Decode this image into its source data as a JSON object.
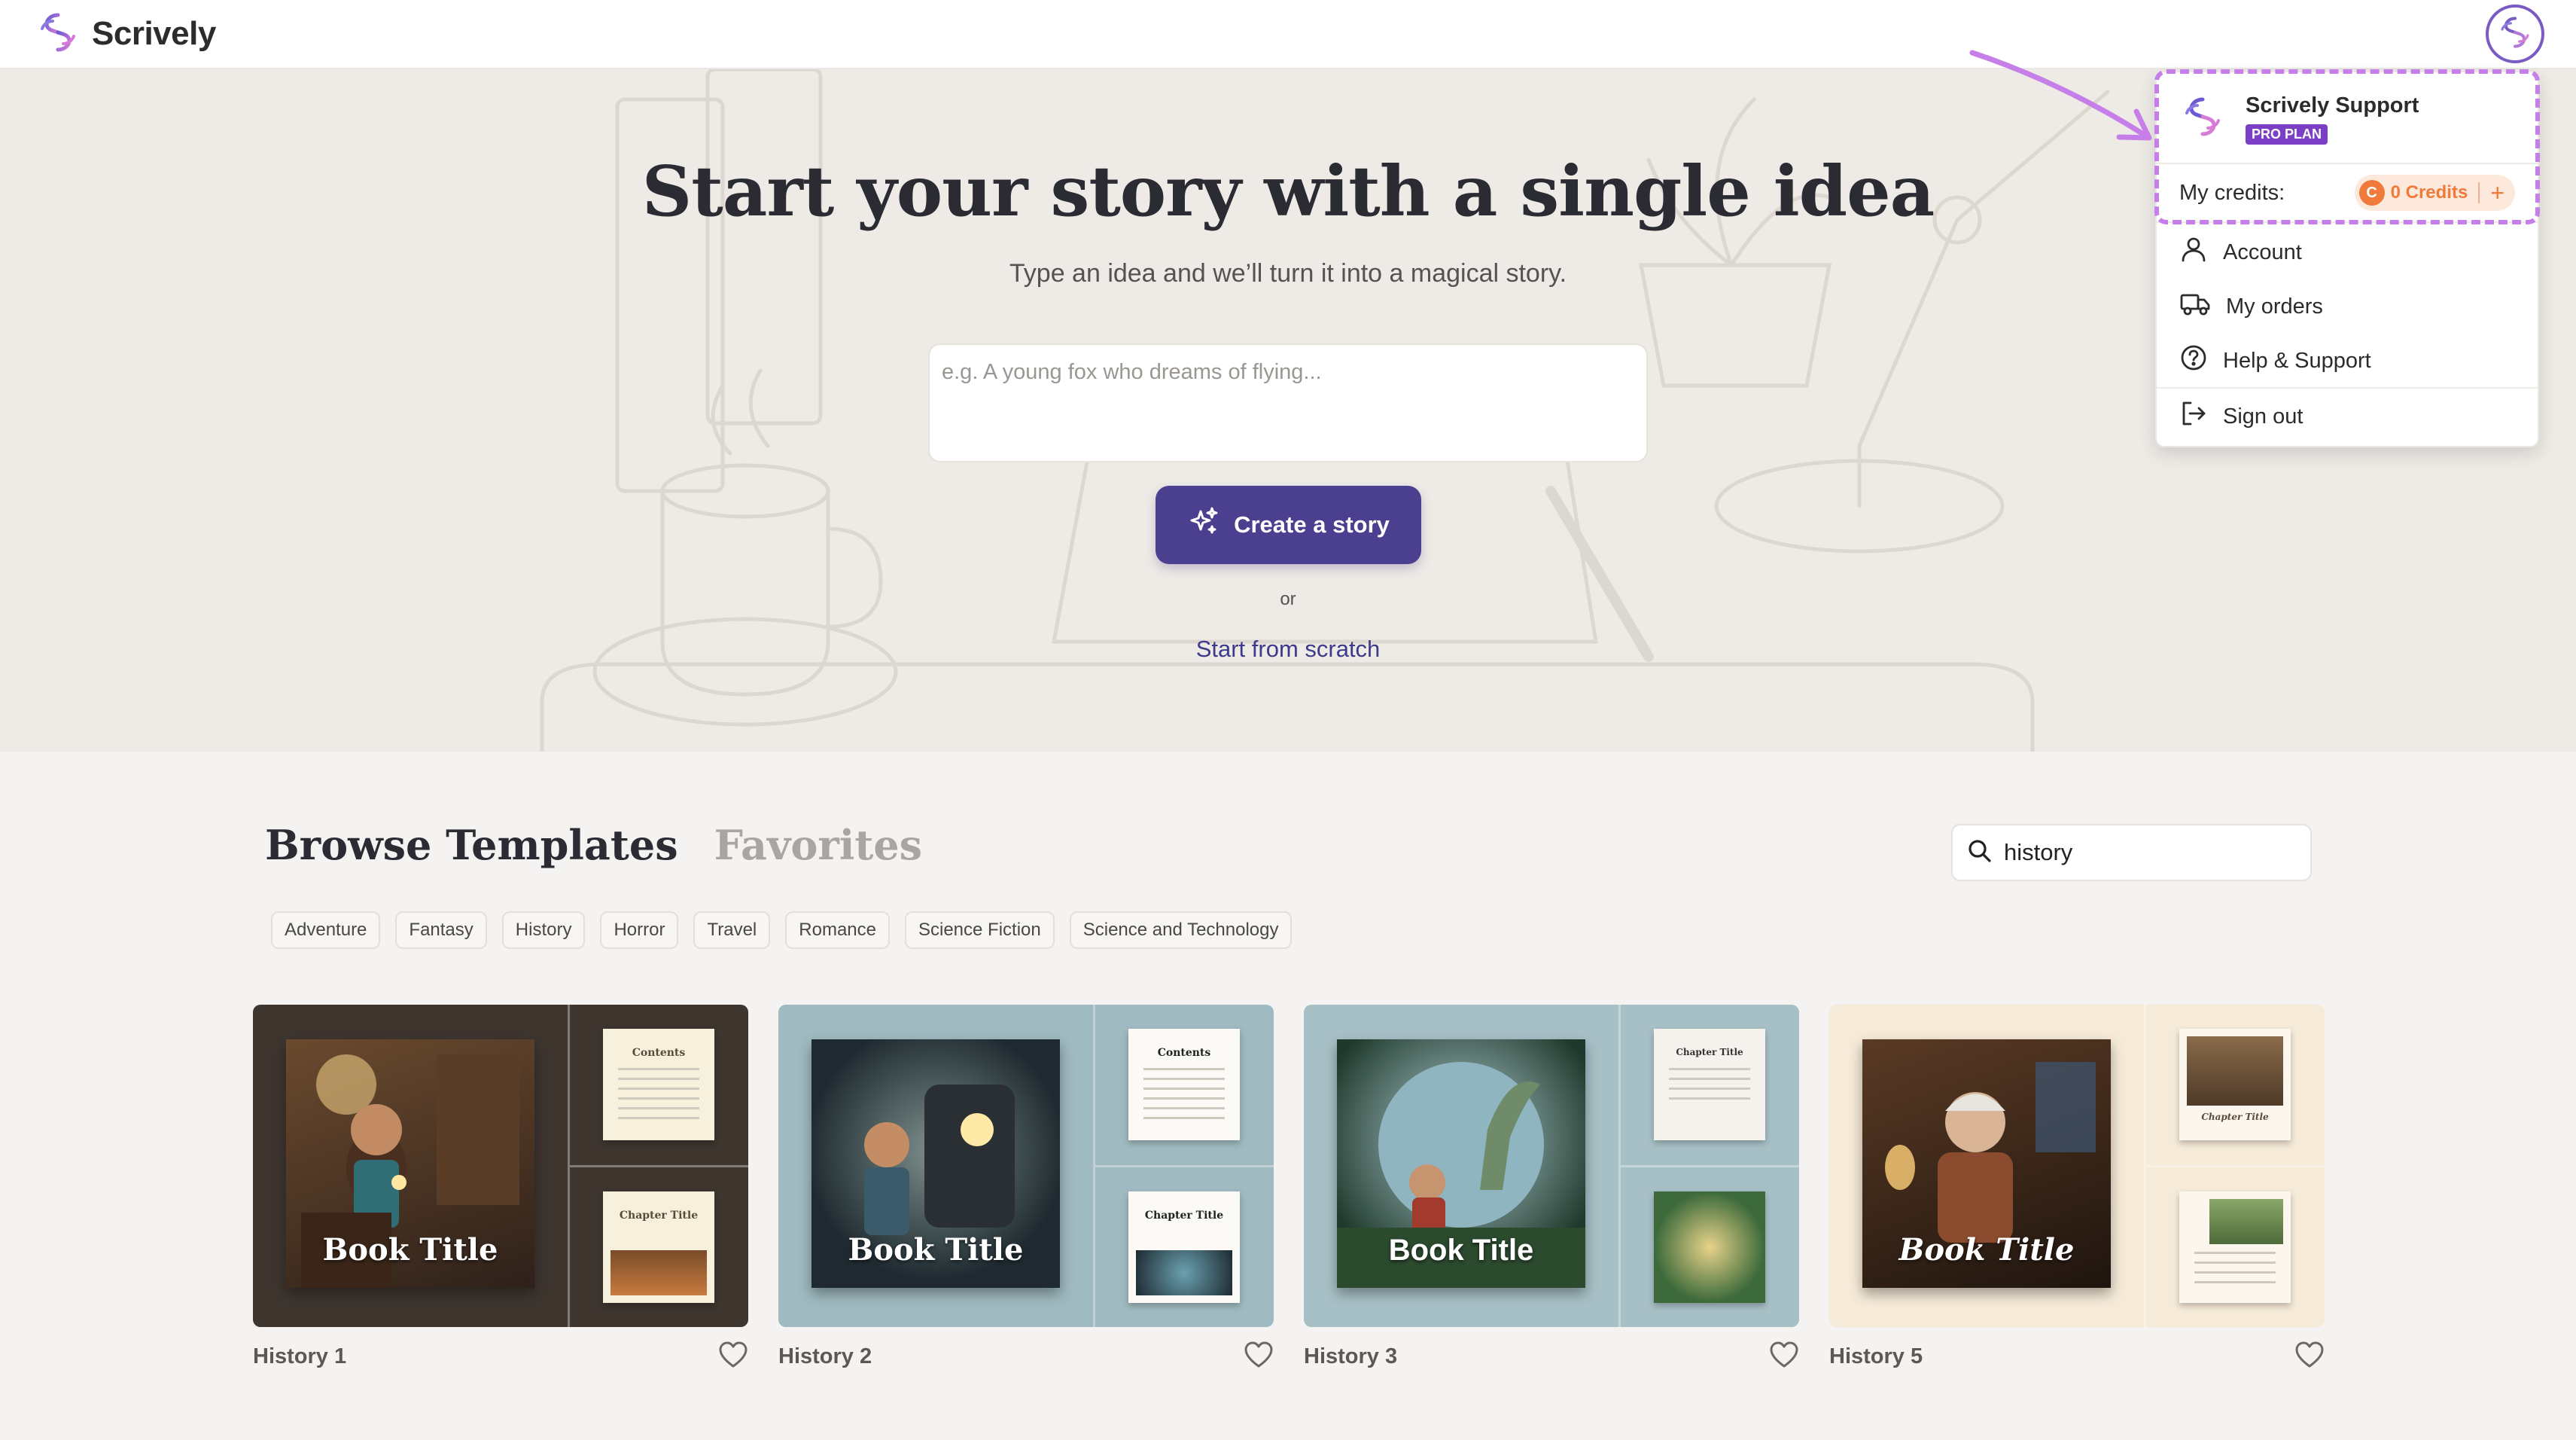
{
  "app": {
    "brand_name": "Scrively",
    "accent_color": "#4b3f8f"
  },
  "hero": {
    "title": "Start your story with a single idea",
    "subtitle": "Type an idea and we’ll turn it into a magical story.",
    "idea_placeholder": "e.g. A young fox who dreams of flying...",
    "create_label": "Create a story",
    "or_text": "or",
    "scratch_label": "Start from scratch"
  },
  "templates": {
    "tabs": [
      "Browse Templates",
      "Favorites"
    ],
    "active_tab": "Browse Templates",
    "search_value": "history",
    "chips": [
      "Adventure",
      "Fantasy",
      "History",
      "Horror",
      "Travel",
      "Romance",
      "Science Fiction",
      "Science and Technology"
    ],
    "cards": [
      {
        "label": "History 1",
        "cover_title": "Book Title",
        "page1_title": "Contents",
        "page2_title": "Chapter Title",
        "bg": "#3e352f"
      },
      {
        "label": "History 2",
        "cover_title": "Book Title",
        "page1_title": "Contents",
        "page2_title": "Chapter Title",
        "bg": "#9fbac0"
      },
      {
        "label": "History 3",
        "cover_title": "Book Title",
        "page1_title": "Chapter Title",
        "page2_title": "",
        "bg": "#a7c0c6"
      },
      {
        "label": "History 5",
        "cover_title": "Book Title",
        "page1_title": "Chapter Title",
        "page2_title": "",
        "bg": "#f6ead8"
      }
    ]
  },
  "user_menu": {
    "name": "Scrively Support",
    "plan": "PRO PLAN",
    "credits_label": "My credits:",
    "credits_value": "0 Credits",
    "coin_letter": "C",
    "add_symbol": "+",
    "items": [
      "Account",
      "My orders",
      "Help & Support",
      "Sign out"
    ]
  }
}
